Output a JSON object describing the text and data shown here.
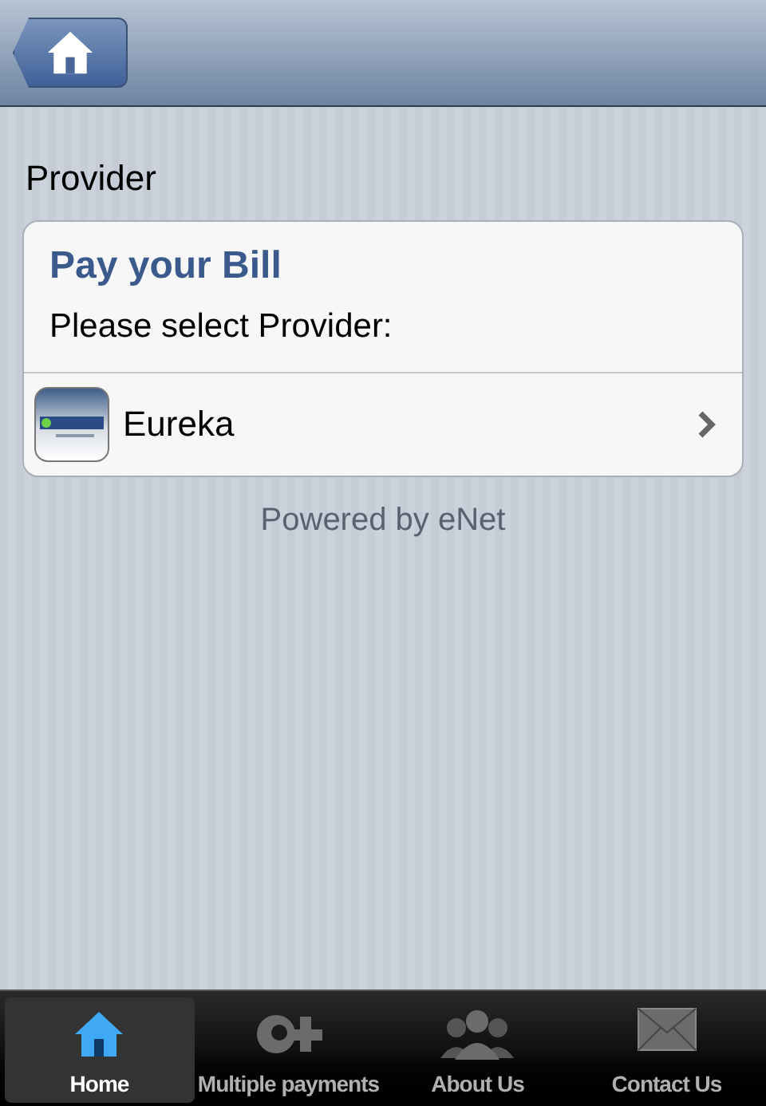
{
  "section_title": "Provider",
  "card": {
    "title": "Pay your Bill",
    "subtitle": "Please select Provider:",
    "providers": [
      {
        "name": "Eureka"
      }
    ]
  },
  "footer": "Powered by eNet",
  "tabs": [
    {
      "label": "Home",
      "kind": "home",
      "selected": true
    },
    {
      "label": "Multiple payments",
      "kind": "payments",
      "selected": false
    },
    {
      "label": "About Us",
      "kind": "people",
      "selected": false
    },
    {
      "label": "Contact Us",
      "kind": "mail",
      "selected": false
    }
  ]
}
